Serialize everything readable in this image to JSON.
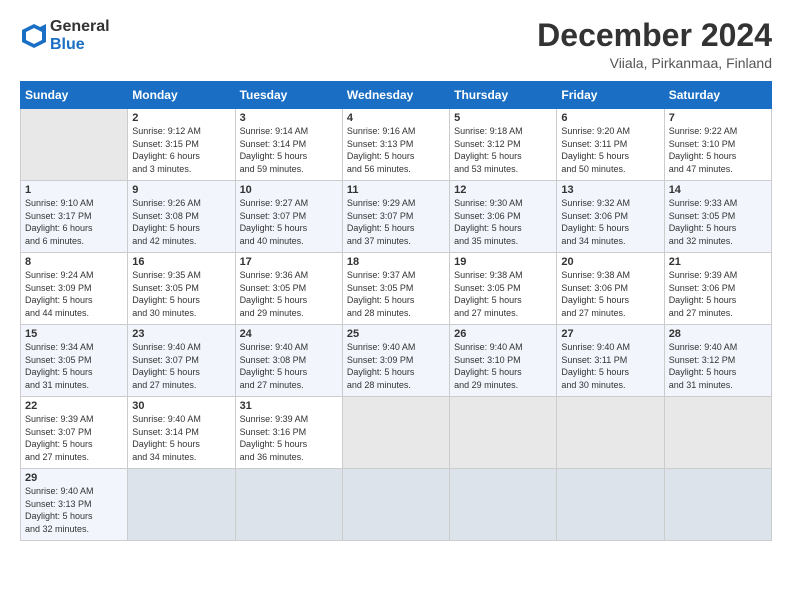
{
  "header": {
    "logo_line1": "General",
    "logo_line2": "Blue",
    "month_title": "December 2024",
    "location": "Viiala, Pirkanmaa, Finland"
  },
  "calendar": {
    "headers": [
      "Sunday",
      "Monday",
      "Tuesday",
      "Wednesday",
      "Thursday",
      "Friday",
      "Saturday"
    ],
    "weeks": [
      [
        {
          "day": "",
          "info": "",
          "empty": true
        },
        {
          "day": "2",
          "info": "Sunrise: 9:12 AM\nSunset: 3:15 PM\nDaylight: 6 hours\nand 3 minutes."
        },
        {
          "day": "3",
          "info": "Sunrise: 9:14 AM\nSunset: 3:14 PM\nDaylight: 5 hours\nand 59 minutes."
        },
        {
          "day": "4",
          "info": "Sunrise: 9:16 AM\nSunset: 3:13 PM\nDaylight: 5 hours\nand 56 minutes."
        },
        {
          "day": "5",
          "info": "Sunrise: 9:18 AM\nSunset: 3:12 PM\nDaylight: 5 hours\nand 53 minutes."
        },
        {
          "day": "6",
          "info": "Sunrise: 9:20 AM\nSunset: 3:11 PM\nDaylight: 5 hours\nand 50 minutes."
        },
        {
          "day": "7",
          "info": "Sunrise: 9:22 AM\nSunset: 3:10 PM\nDaylight: 5 hours\nand 47 minutes."
        }
      ],
      [
        {
          "day": "1",
          "info": "Sunrise: 9:10 AM\nSunset: 3:17 PM\nDaylight: 6 hours\nand 6 minutes."
        },
        {
          "day": "9",
          "info": "Sunrise: 9:26 AM\nSunset: 3:08 PM\nDaylight: 5 hours\nand 42 minutes."
        },
        {
          "day": "10",
          "info": "Sunrise: 9:27 AM\nSunset: 3:07 PM\nDaylight: 5 hours\nand 40 minutes."
        },
        {
          "day": "11",
          "info": "Sunrise: 9:29 AM\nSunset: 3:07 PM\nDaylight: 5 hours\nand 37 minutes."
        },
        {
          "day": "12",
          "info": "Sunrise: 9:30 AM\nSunset: 3:06 PM\nDaylight: 5 hours\nand 35 minutes."
        },
        {
          "day": "13",
          "info": "Sunrise: 9:32 AM\nSunset: 3:06 PM\nDaylight: 5 hours\nand 34 minutes."
        },
        {
          "day": "14",
          "info": "Sunrise: 9:33 AM\nSunset: 3:05 PM\nDaylight: 5 hours\nand 32 minutes."
        }
      ],
      [
        {
          "day": "8",
          "info": "Sunrise: 9:24 AM\nSunset: 3:09 PM\nDaylight: 5 hours\nand 44 minutes."
        },
        {
          "day": "16",
          "info": "Sunrise: 9:35 AM\nSunset: 3:05 PM\nDaylight: 5 hours\nand 30 minutes."
        },
        {
          "day": "17",
          "info": "Sunrise: 9:36 AM\nSunset: 3:05 PM\nDaylight: 5 hours\nand 29 minutes."
        },
        {
          "day": "18",
          "info": "Sunrise: 9:37 AM\nSunset: 3:05 PM\nDaylight: 5 hours\nand 28 minutes."
        },
        {
          "day": "19",
          "info": "Sunrise: 9:38 AM\nSunset: 3:05 PM\nDaylight: 5 hours\nand 27 minutes."
        },
        {
          "day": "20",
          "info": "Sunrise: 9:38 AM\nSunset: 3:06 PM\nDaylight: 5 hours\nand 27 minutes."
        },
        {
          "day": "21",
          "info": "Sunrise: 9:39 AM\nSunset: 3:06 PM\nDaylight: 5 hours\nand 27 minutes."
        }
      ],
      [
        {
          "day": "15",
          "info": "Sunrise: 9:34 AM\nSunset: 3:05 PM\nDaylight: 5 hours\nand 31 minutes."
        },
        {
          "day": "23",
          "info": "Sunrise: 9:40 AM\nSunset: 3:07 PM\nDaylight: 5 hours\nand 27 minutes."
        },
        {
          "day": "24",
          "info": "Sunrise: 9:40 AM\nSunset: 3:08 PM\nDaylight: 5 hours\nand 27 minutes."
        },
        {
          "day": "25",
          "info": "Sunrise: 9:40 AM\nSunset: 3:09 PM\nDaylight: 5 hours\nand 28 minutes."
        },
        {
          "day": "26",
          "info": "Sunrise: 9:40 AM\nSunset: 3:10 PM\nDaylight: 5 hours\nand 29 minutes."
        },
        {
          "day": "27",
          "info": "Sunrise: 9:40 AM\nSunset: 3:11 PM\nDaylight: 5 hours\nand 30 minutes."
        },
        {
          "day": "28",
          "info": "Sunrise: 9:40 AM\nSunset: 3:12 PM\nDaylight: 5 hours\nand 31 minutes."
        }
      ],
      [
        {
          "day": "22",
          "info": "Sunrise: 9:39 AM\nSunset: 3:07 PM\nDaylight: 5 hours\nand 27 minutes."
        },
        {
          "day": "30",
          "info": "Sunrise: 9:40 AM\nSunset: 3:14 PM\nDaylight: 5 hours\nand 34 minutes."
        },
        {
          "day": "31",
          "info": "Sunrise: 9:39 AM\nSunset: 3:16 PM\nDaylight: 5 hours\nand 36 minutes."
        },
        {
          "day": "",
          "info": "",
          "empty": true
        },
        {
          "day": "",
          "info": "",
          "empty": true
        },
        {
          "day": "",
          "info": "",
          "empty": true
        },
        {
          "day": "",
          "info": "",
          "empty": true
        }
      ],
      [
        {
          "day": "29",
          "info": "Sunrise: 9:40 AM\nSunset: 3:13 PM\nDaylight: 5 hours\nand 32 minutes."
        },
        {
          "day": "",
          "info": "",
          "empty": true
        },
        {
          "day": "",
          "info": "",
          "empty": true
        },
        {
          "day": "",
          "info": "",
          "empty": true
        },
        {
          "day": "",
          "info": "",
          "empty": true
        },
        {
          "day": "",
          "info": "",
          "empty": true
        },
        {
          "day": "",
          "info": "",
          "empty": true
        }
      ]
    ]
  }
}
